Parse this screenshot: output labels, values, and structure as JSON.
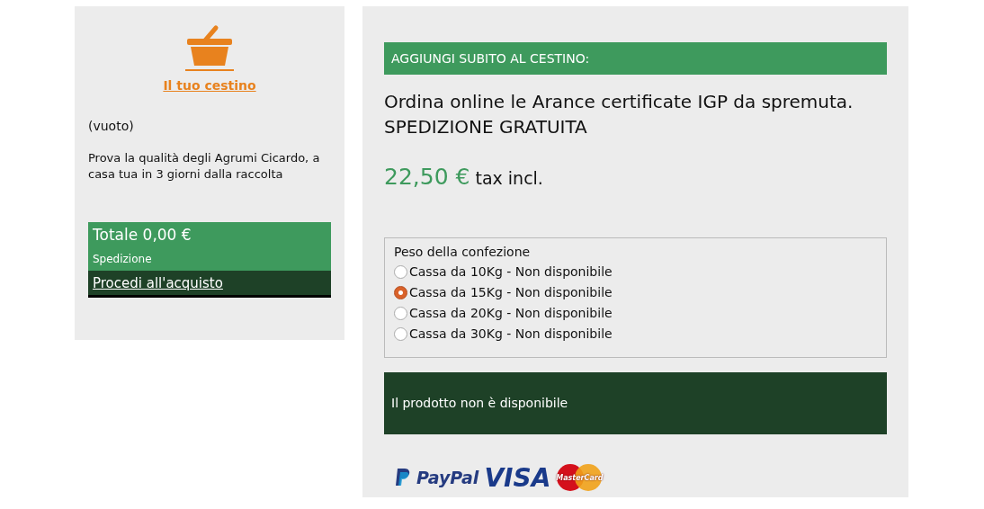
{
  "cart": {
    "title": "Il tuo cestino",
    "status": "(vuoto)",
    "promo": "Prova la qualità degli Agrumi Cicardo, a casa tua in 3 giorni dalla raccolta",
    "total": "Totale 0,00 €",
    "shipping": "Spedizione",
    "checkout": "Procedi all'acquisto"
  },
  "product": {
    "banner": "AGGIUNGI SUBITO AL CESTINO:",
    "title": "Ordina online le Arance certificate IGP da spremuta. SPEDIZIONE GRATUITA",
    "price": "22,50 €",
    "tax": "tax incl.",
    "options": {
      "legend": "Peso della confezione",
      "items": [
        {
          "label": "Cassa da 10Kg - Non disponibile",
          "selected": false
        },
        {
          "label": "Cassa da 15Kg - Non disponibile",
          "selected": true
        },
        {
          "label": "Cassa da 20Kg - Non disponibile",
          "selected": false
        },
        {
          "label": "Cassa da 30Kg - Non disponibile",
          "selected": false
        }
      ]
    },
    "availability": "Il prodotto non è disponibile",
    "payments": [
      {
        "kind": "paypal",
        "label": "PayPal"
      },
      {
        "kind": "visa",
        "label": "VISA"
      },
      {
        "kind": "mastercard",
        "label": "MasterCard"
      }
    ]
  }
}
